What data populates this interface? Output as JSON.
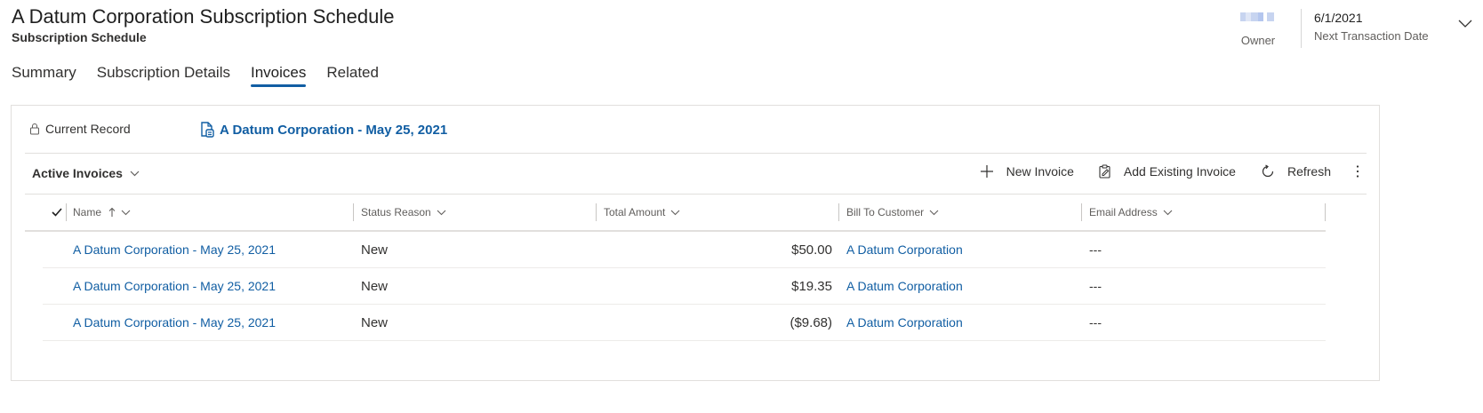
{
  "header": {
    "title": "A Datum Corporation Subscription Schedule",
    "subtitle": "Subscription Schedule",
    "owner_label": "Owner",
    "next_date_value": "6/1/2021",
    "next_date_label": "Next Transaction Date"
  },
  "tabs": [
    {
      "label": "Summary",
      "active": false
    },
    {
      "label": "Subscription Details",
      "active": false
    },
    {
      "label": "Invoices",
      "active": true
    },
    {
      "label": "Related",
      "active": false
    }
  ],
  "panel": {
    "current_record_label": "Current Record",
    "record_link": "A Datum Corporation - May 25, 2021",
    "view_name": "Active Invoices",
    "toolbar": {
      "new_invoice": "New Invoice",
      "add_existing_invoice": "Add Existing Invoice",
      "refresh": "Refresh"
    }
  },
  "grid": {
    "columns": [
      "Name",
      "Status Reason",
      "Total Amount",
      "Bill To Customer",
      "Email Address"
    ],
    "rows": [
      {
        "name": "A Datum Corporation - May 25, 2021",
        "status": "New",
        "amount": "$50.00",
        "bill_to": "A Datum Corporation",
        "email": "---"
      },
      {
        "name": "A Datum Corporation - May 25, 2021",
        "status": "New",
        "amount": "$19.35",
        "bill_to": "A Datum Corporation",
        "email": "---"
      },
      {
        "name": "A Datum Corporation - May 25, 2021",
        "status": "New",
        "amount": "($9.68)",
        "bill_to": "A Datum Corporation",
        "email": "---"
      }
    ]
  },
  "colors": {
    "link": "#115ea3",
    "tab_underline": "#115ea3",
    "text": "#323130",
    "secondary_text": "#605e5c"
  },
  "icons": [
    "lock-icon",
    "document-icon",
    "chevron-down-icon",
    "plus-icon",
    "clipboard-icon",
    "refresh-icon",
    "more-vertical-icon",
    "checkmark-icon",
    "sort-ascending-icon"
  ]
}
